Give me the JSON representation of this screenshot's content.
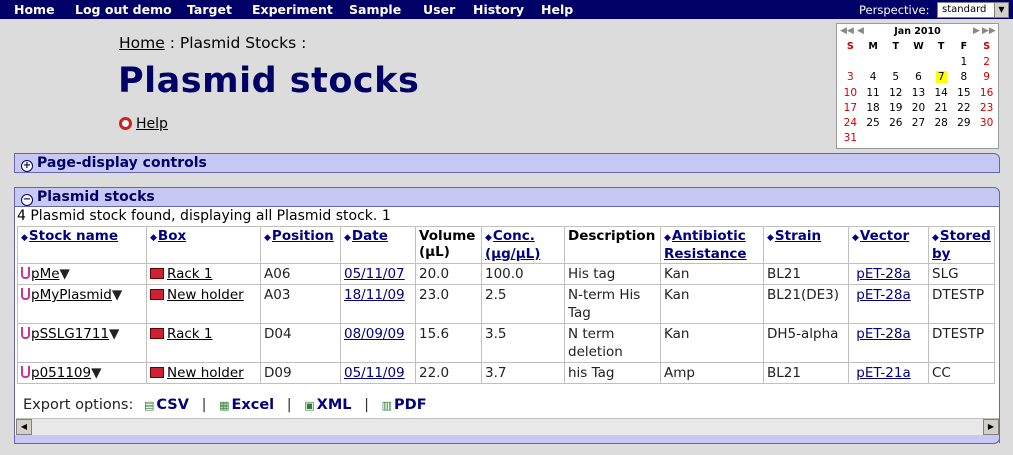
{
  "nav": {
    "items": [
      "Home",
      "Log out demo",
      "Target",
      "Experiment",
      "Sample",
      "User",
      "History",
      "Help"
    ],
    "perspective_label": "Perspective:",
    "perspective_value": "standard"
  },
  "breadcrumb": {
    "home": "Home",
    "current": " : Plasmid Stocks :"
  },
  "page_title": "Plasmid stocks",
  "help_link": "Help",
  "calendar": {
    "month": "Jan 2010",
    "weekdays": [
      "S",
      "M",
      "T",
      "W",
      "T",
      "F",
      "S"
    ],
    "rows": [
      [
        "",
        "",
        "",
        "",
        "",
        "1",
        "2"
      ],
      [
        "3",
        "4",
        "5",
        "6",
        "7",
        "8",
        "9"
      ],
      [
        "10",
        "11",
        "12",
        "13",
        "14",
        "15",
        "16"
      ],
      [
        "17",
        "18",
        "19",
        "20",
        "21",
        "22",
        "23"
      ],
      [
        "24",
        "25",
        "26",
        "27",
        "28",
        "29",
        "30"
      ],
      [
        "31",
        "",
        "",
        "",
        "",
        "",
        ""
      ]
    ],
    "today": "7",
    "weekend_color": "#cc0000",
    "today_color": "#ffff00"
  },
  "panels": {
    "controls_title": "Page-display controls",
    "stocks_title": "Plasmid stocks"
  },
  "found_text": "4 Plasmid stock found, displaying all Plasmid stock.",
  "page_number": "1",
  "table": {
    "headers": {
      "stock_name": "Stock name",
      "box": "Box",
      "position": "Position",
      "date": "Date",
      "volume_1": "Volume",
      "volume_2": "(µL)",
      "conc_1": "Conc.",
      "conc_2": "(µg/µL)",
      "description": "Description",
      "antibiotic_1": "Antibiotic",
      "antibiotic_2": "Resistance",
      "strain": "Strain",
      "vector": "Vector",
      "stored_1": "Stored",
      "stored_2": "by"
    },
    "rows": [
      {
        "name": "pMe",
        "box": "Rack 1",
        "position": "A06",
        "date": "05/11/07",
        "volume": "20.0",
        "conc": "100.0",
        "desc_1": "His tag",
        "desc_2": "",
        "antibiotic": "Kan",
        "strain": "BL21",
        "vector": "pET-28a",
        "stored": "SLG"
      },
      {
        "name": "pMyPlasmid",
        "box": "New holder",
        "position": "A03",
        "date": "18/11/09",
        "volume": "23.0",
        "conc": "2.5",
        "desc_1": "N-term His",
        "desc_2": "Tag",
        "antibiotic": "Kan",
        "strain": "BL21(DE3)",
        "vector": "pET-28a",
        "stored": "DTESTP"
      },
      {
        "name": "pSSLG1711",
        "box": "Rack 1",
        "position": "D04",
        "date": "08/09/09",
        "volume": "15.6",
        "conc": "3.5",
        "desc_1": "N term",
        "desc_2": "deletion",
        "antibiotic": "Kan",
        "strain": "DH5-alpha",
        "vector": "pET-28a",
        "stored": "DTESTP"
      },
      {
        "name": "p051109",
        "box": "New holder",
        "position": "D09",
        "date": "05/11/09",
        "volume": "22.0",
        "conc": "3.7",
        "desc_1": "his Tag",
        "desc_2": "",
        "antibiotic": "Amp",
        "strain": "BL21",
        "vector": "pET-21a",
        "stored": "CC"
      }
    ]
  },
  "export": {
    "label": "Export options:",
    "options": [
      "CSV",
      "Excel",
      "XML",
      "PDF"
    ]
  },
  "colors": {
    "nav_bg": "#000066",
    "title": "#000066",
    "panel_bar": "#c8c8f4",
    "link_blue": "#000080"
  }
}
